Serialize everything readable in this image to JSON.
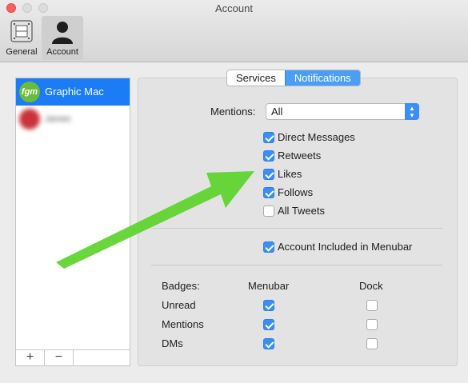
{
  "window": {
    "title": "Account"
  },
  "toolbar": {
    "general_label": "General",
    "account_label": "Account"
  },
  "accounts": [
    {
      "name": "Graphic Mac",
      "avatar_text": "fgm",
      "selected": true
    },
    {
      "name": "James",
      "selected": false
    }
  ],
  "sidebar_buttons": {
    "add": "+",
    "remove": "−"
  },
  "tabs": {
    "services": "Services",
    "notifications": "Notifications",
    "active": "Notifications"
  },
  "mentions": {
    "label": "Mentions:",
    "value": "All"
  },
  "notification_options": [
    {
      "label": "Direct Messages",
      "checked": true
    },
    {
      "label": "Retweets",
      "checked": true
    },
    {
      "label": "Likes",
      "checked": true
    },
    {
      "label": "Follows",
      "checked": true
    },
    {
      "label": "All Tweets",
      "checked": false
    }
  ],
  "menubar_option": {
    "label": "Account Included in Menubar",
    "checked": true
  },
  "badges": {
    "header": "Badges:",
    "col_menubar": "Menubar",
    "col_dock": "Dock",
    "rows": [
      {
        "label": "Unread",
        "menubar": true,
        "dock": false
      },
      {
        "label": "Mentions",
        "menubar": true,
        "dock": false
      },
      {
        "label": "DMs",
        "menubar": true,
        "dock": false
      }
    ]
  },
  "colors": {
    "accent": "#3a8ef6",
    "selection": "#1b7cf5",
    "arrow": "#5cd32a"
  }
}
